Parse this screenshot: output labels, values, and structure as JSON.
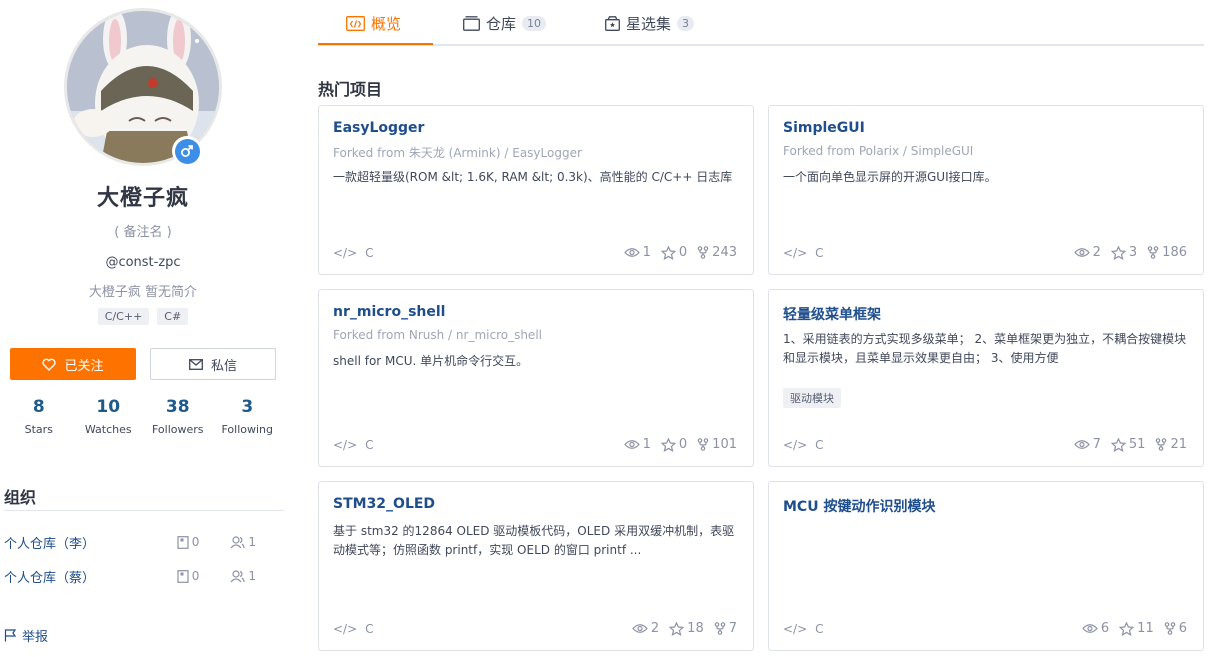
{
  "profile": {
    "name": "大橙子疯",
    "remark": "( 备注名 )",
    "handle": "@const-zpc",
    "bio": "大橙子疯 暂无简介",
    "languages": [
      "C/C++",
      "C#"
    ],
    "follow_label": "已关注",
    "message_label": "私信",
    "stats": [
      {
        "value": "8",
        "label": "Stars"
      },
      {
        "value": "10",
        "label": "Watches"
      },
      {
        "value": "38",
        "label": "Followers"
      },
      {
        "value": "3",
        "label": "Following"
      }
    ],
    "accent_color": "#fe7300"
  },
  "orgs": {
    "title": "组织",
    "items": [
      {
        "name": "个人仓库（李）",
        "repos": "0",
        "members": "1"
      },
      {
        "name": "个人仓库（蔡）",
        "repos": "0",
        "members": "1"
      }
    ]
  },
  "report_label": "举报",
  "tabs": [
    {
      "label": "概览",
      "count": ""
    },
    {
      "label": "仓库",
      "count": "10"
    },
    {
      "label": "星选集",
      "count": "3"
    }
  ],
  "section_title": "热门项目",
  "projects": [
    {
      "title": "EasyLogger",
      "fork_prefix": "Forked from",
      "fork_owner": "朱天龙 (Armink)",
      "fork_repo": "/ EasyLogger",
      "desc": "一款超轻量级(ROM &lt; 1.6K, RAM &lt; 0.3k)、高性能的 C/C++ 日志库",
      "tag": "",
      "lang": "C",
      "watches": "1",
      "stars": "0",
      "forks": "243"
    },
    {
      "title": "SimpleGUI",
      "fork_prefix": "Forked from",
      "fork_owner": "Polarix",
      "fork_repo": "/ SimpleGUI",
      "desc": "一个面向单色显示屏的开源GUI接口库。",
      "tag": "",
      "lang": "C",
      "watches": "2",
      "stars": "3",
      "forks": "186"
    },
    {
      "title": "nr_micro_shell",
      "fork_prefix": "Forked from",
      "fork_owner": "Nrush",
      "fork_repo": "/ nr_micro_shell",
      "desc": "shell for MCU. 单片机命令行交互。",
      "tag": "",
      "lang": "C",
      "watches": "1",
      "stars": "0",
      "forks": "101"
    },
    {
      "title": "轻量级菜单框架",
      "fork_prefix": "",
      "fork_owner": "",
      "fork_repo": "",
      "desc": "1、采用链表的方式实现多级菜单； 2、菜单框架更为独立，不耦合按键模块和显示模块，且菜单显示效果更自由； 3、使用方便",
      "tag": "驱动模块",
      "lang": "C",
      "watches": "7",
      "stars": "51",
      "forks": "21"
    },
    {
      "title": "STM32_OLED",
      "fork_prefix": "",
      "fork_owner": "",
      "fork_repo": "",
      "desc": "基于 stm32 的12864 OLED 驱动模板代码，OLED 采用双缓冲机制，表驱动模式等；仿照函数 printf，实现 OELD 的窗口 printf ...",
      "tag": "",
      "lang": "C",
      "watches": "2",
      "stars": "18",
      "forks": "7"
    },
    {
      "title": "MCU 按键动作识别模块",
      "fork_prefix": "",
      "fork_owner": "",
      "fork_repo": "",
      "desc": "",
      "tag": "",
      "lang": "C",
      "watches": "6",
      "stars": "11",
      "forks": "6"
    }
  ]
}
